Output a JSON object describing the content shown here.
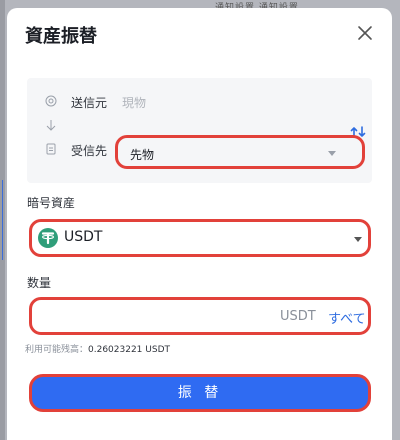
{
  "background": {
    "header_text": "通知設置 通知設置"
  },
  "modal": {
    "title": "資産振替",
    "route": {
      "from_label": "送信元",
      "from_value": "現物",
      "to_label": "受信先",
      "to_value": "先物"
    },
    "asset": {
      "label": "暗号資産",
      "selected": "USDT",
      "coin_symbol": "₮"
    },
    "amount": {
      "label": "数量",
      "unit": "USDT",
      "all_label": "すべて"
    },
    "available": {
      "label": "利用可能残高：",
      "value": "0.26023221 USDT"
    },
    "submit_label": "振 替"
  },
  "colors": {
    "accent": "#2f6bf2",
    "highlight": "#e2413a",
    "coin": "#2f9e7a"
  }
}
